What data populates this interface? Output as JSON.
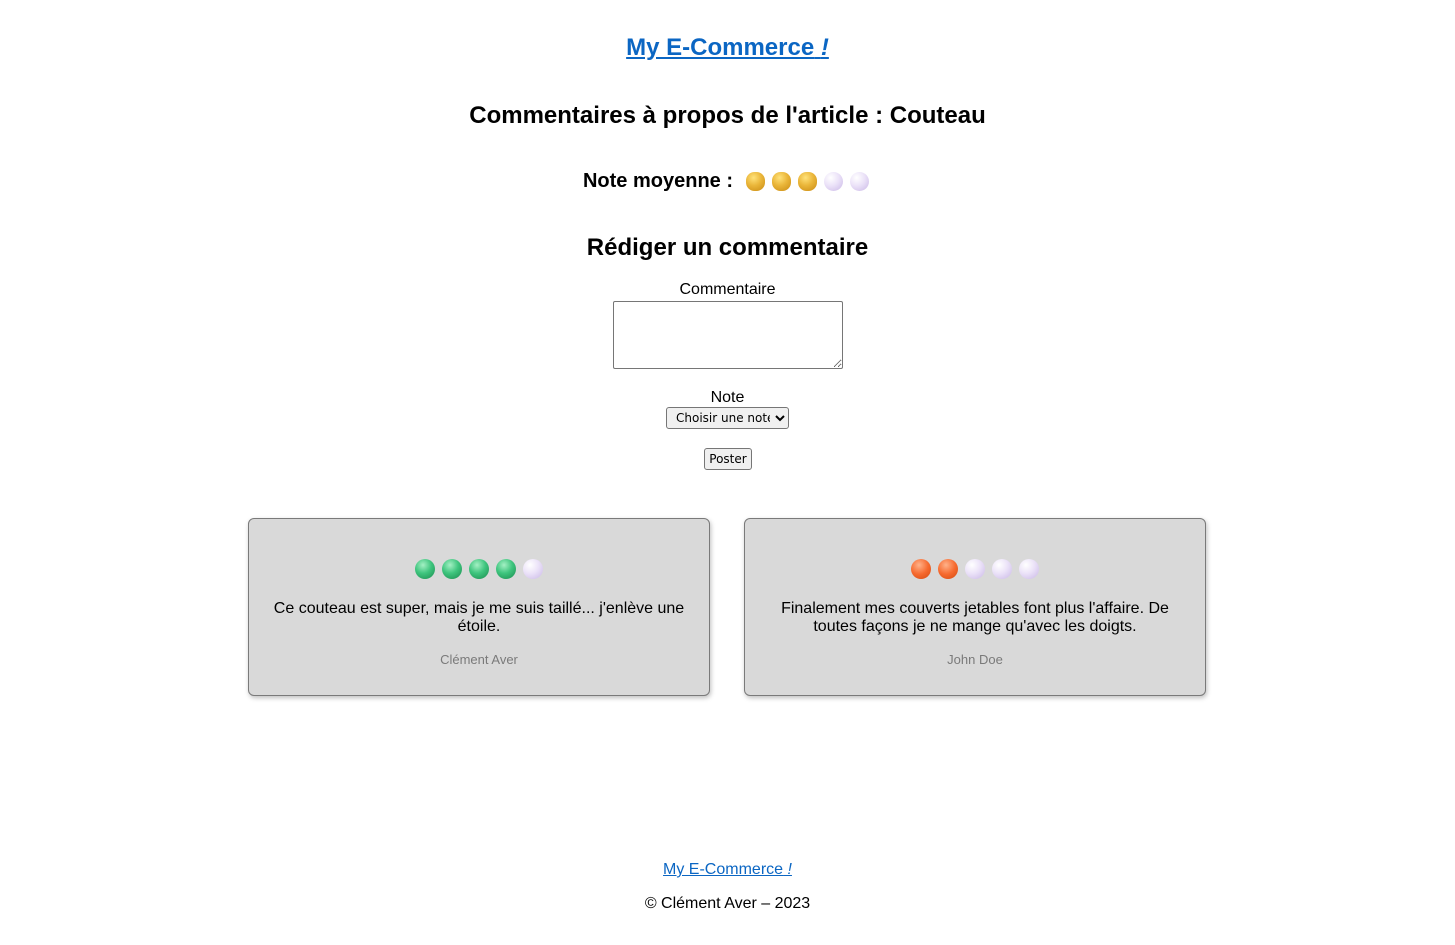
{
  "header": {
    "site_name": "My E-Commerce",
    "site_suffix": "!"
  },
  "article": {
    "heading": "Commentaires à propos de l'article : Couteau"
  },
  "average_rating": {
    "label": "Note moyenne :",
    "value": 3,
    "max": 5,
    "filled_color": "#eab63a",
    "empty_color": "#e4dbf5"
  },
  "form": {
    "heading": "Rédiger un commentaire",
    "comment_label": "Commentaire",
    "comment_value": "",
    "note_label": "Note",
    "note_selected": "Choisir une note",
    "submit_label": "Poster"
  },
  "comments": [
    {
      "rating": 4,
      "max": 5,
      "color": "#3fc57e",
      "text": "Ce couteau est super, mais je me suis taillé... j'enlève une étoile.",
      "author": "Clément Aver"
    },
    {
      "rating": 2,
      "max": 5,
      "color": "#f66a2f",
      "text": "Finalement mes couverts jetables font plus l'affaire. De toutes façons je ne mange qu'avec les doigts.",
      "author": "John Doe"
    }
  ],
  "footer": {
    "site_name": "My E-Commerce",
    "site_suffix": "!",
    "copyright": "© Clément Aver – 2023"
  }
}
